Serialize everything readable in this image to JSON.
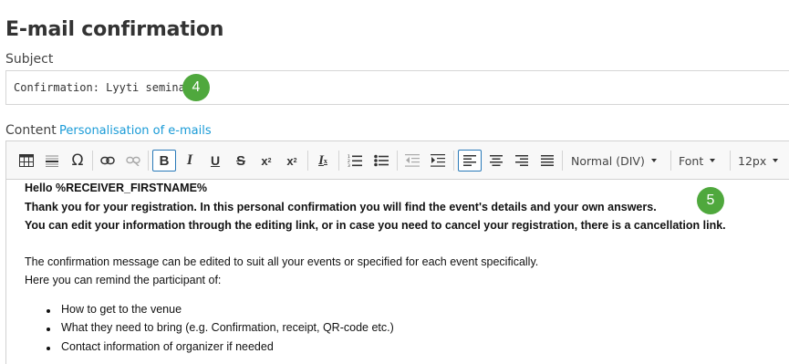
{
  "page": {
    "title": "E-mail confirmation"
  },
  "subject": {
    "label": "Subject",
    "value": "Confirmation: Lyyti seminar",
    "badge": "4"
  },
  "content": {
    "label": "Content",
    "link": "Personalisation of e-mails",
    "badge": "5"
  },
  "toolbar": {
    "format": "Normal (DIV)",
    "font": "Font",
    "size": "12px",
    "icons": [
      "table-icon",
      "horizontal-line-icon",
      "special-char-icon",
      "link-icon",
      "unlink-icon",
      "bold-icon",
      "italic-icon",
      "underline-icon",
      "strikethrough-icon",
      "subscript-icon",
      "superscript-icon",
      "remove-format-icon",
      "numbered-list-icon",
      "bulleted-list-icon",
      "outdent-icon",
      "indent-icon",
      "align-left-icon",
      "align-center-icon",
      "align-right-icon",
      "justify-icon"
    ],
    "active_color": "#2a7ab9"
  },
  "editor": {
    "greeting": "Hello %RECEIVER_FIRSTNAME%",
    "line1": "Thank you for your registration. In this personal confirmation you will find the event's details and your own answers.",
    "line2": "You can edit your information through the editing link, or in case you need to cancel your registration, there is a cancellation link.",
    "line3": "The confirmation message can be edited to suit all your events or specified for each event specifically.",
    "line4": "Here you can remind the participant of:",
    "bullets": [
      "How to get to the venue",
      "What they need to bring (e.g. Confirmation, receipt, QR-code etc.)",
      "Contact information of organizer if needed"
    ]
  },
  "colors": {
    "badge": "#4fa83d",
    "link": "#1a9bd7"
  }
}
